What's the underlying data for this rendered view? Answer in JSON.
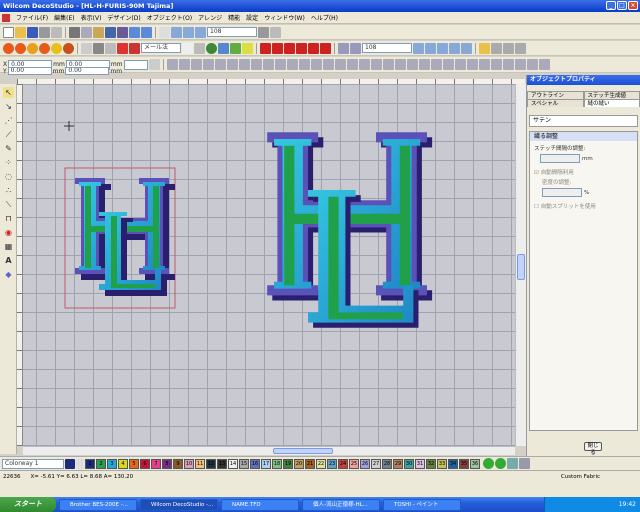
{
  "window": {
    "title": "Wilcom DecoStudio - [HL-H-FURIS-90M    Tajima]"
  },
  "menu": [
    "ファイル(F)",
    "編集(E)",
    "表示(V)",
    "デザイン(D)",
    "オブジェクト(O)",
    "アレンジ",
    "精能",
    "設定",
    "ウィンドウ(W)",
    "ヘルプ(H)"
  ],
  "toolbar1": {
    "zoom_value": "108",
    "mode_label": "メール法"
  },
  "toolbar3": {
    "zoom_value": "108"
  },
  "coords": {
    "x_label": "X",
    "x_value": "0.00",
    "y_label": "Y",
    "y_value": "0.00",
    "unit": "mm",
    "w_value": "0.00",
    "h_value": "0.00"
  },
  "panel": {
    "title": "オブジェクトプロパティ",
    "tabs_row1": [
      "アウトライン",
      "ステッチ生成値"
    ],
    "tabs_row2": [
      "スペシャル",
      "縫の縫い"
    ],
    "stitch_type": "サテン",
    "section_title": "繊る調整",
    "row1_label": "ステッチ間隔の調整:",
    "row1_unit": "mm",
    "check1": "自動間隔利用",
    "row2_label": "密度の調整:",
    "row2_unit": "%",
    "check2": "自動スプリットを使用",
    "close_button": "閉じる"
  },
  "colorway": {
    "label": "Colorway 1",
    "numbers": [
      "1",
      "2",
      "3",
      "4",
      "5",
      "6",
      "7",
      "8",
      "9",
      "10",
      "11",
      "12",
      "13",
      "14",
      "15",
      "16",
      "17",
      "18",
      "19",
      "20",
      "21",
      "22",
      "23",
      "24",
      "25",
      "26",
      "27",
      "28",
      "29",
      "30",
      "31",
      "32",
      "33",
      "34",
      "35",
      "36"
    ],
    "colors": [
      "#1b2a7a",
      "#2a9c56",
      "#20a7d8",
      "#d8d820",
      "#e06a1a",
      "#c8143a",
      "#e23f8c",
      "#7a2c8c",
      "#8a5a2a",
      "#d8a0b8",
      "#f0c080",
      "#203040",
      "#303030",
      "#f0f0f0",
      "#a8a8a8",
      "#6070c0",
      "#b0d0f0",
      "#80c080",
      "#408040",
      "#c0a060",
      "#a06020",
      "#e0e0a0",
      "#60a0c0",
      "#c04040",
      "#f0a0a0",
      "#a0a0e0",
      "#d0d0d0",
      "#708090",
      "#b08060",
      "#40a0a0",
      "#e0c0e0",
      "#608040",
      "#c0c060",
      "#2060a0",
      "#804040",
      "#a0c0a0"
    ]
  },
  "status": {
    "stitches": "22636",
    "coords": "X= -5.61  Y= 6.63  L= 8.68  A= 130.20",
    "fabric": "Custom Fabric"
  },
  "taskbar": {
    "start": "スタート",
    "tasks": [
      "Brother BES-200E -...",
      "Wilcom DecoStudio -...",
      "NAME.TFD",
      "個人-流山正徳様-HL...",
      "TOSHI - ペイント"
    ],
    "clock": "19:42"
  }
}
